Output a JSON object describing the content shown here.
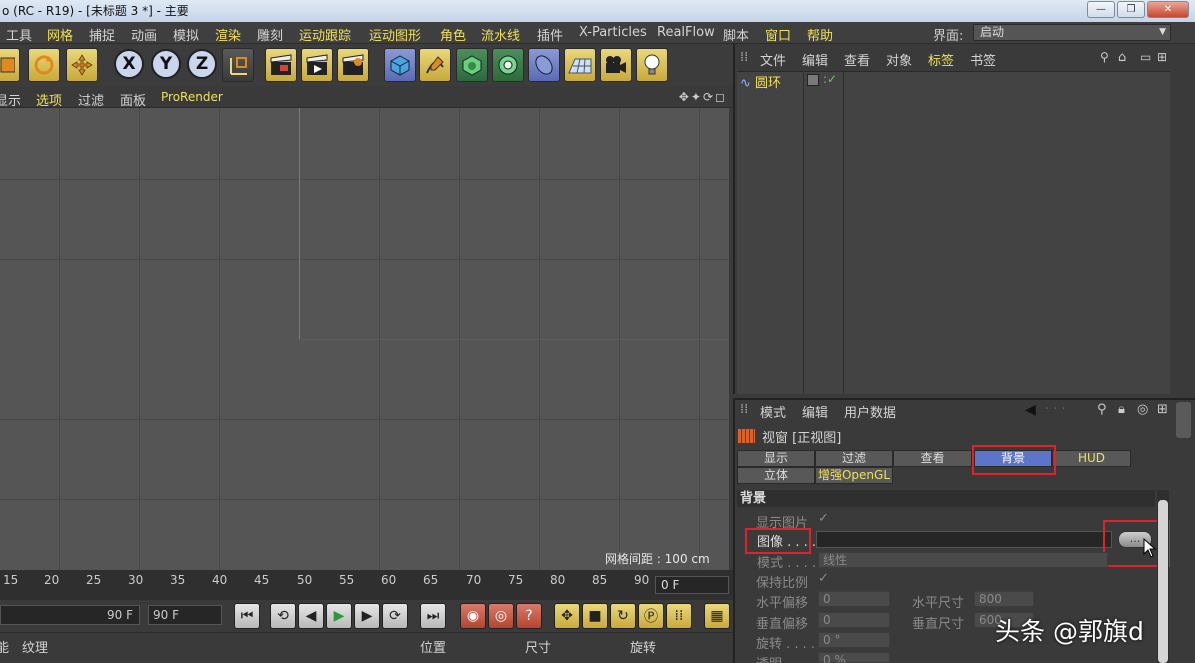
{
  "window": {
    "title": "o (RC - R19) - [未标题 3 *] - 主要",
    "minimize": "—",
    "restore": "❐",
    "close": "✕"
  },
  "menubar": {
    "items": [
      "工具",
      "网格",
      "捕捉",
      "动画",
      "模拟",
      "渲染",
      "雕刻",
      "运动跟踪",
      "运动图形",
      "角色",
      "流水线",
      "插件",
      "X-Particles",
      "RealFlow",
      "脚本",
      "窗口",
      "帮助"
    ],
    "interface_label": "界面:",
    "interface_value": "启动"
  },
  "toolbar": {
    "axis_x": "X",
    "axis_y": "Y",
    "axis_z": "Z"
  },
  "viewport_menu": {
    "items": [
      "显示",
      "选项",
      "过滤",
      "面板",
      "ProRender"
    ],
    "icons": "✥✦⟳◻"
  },
  "viewport": {
    "grid_spacing": "网格间距 : 100 cm"
  },
  "timeline": {
    "ticks": [
      "15",
      "20",
      "25",
      "30",
      "35",
      "40",
      "45",
      "50",
      "55",
      "60",
      "65",
      "70",
      "75",
      "80",
      "85",
      "90"
    ],
    "current_frame": "0 F",
    "end_left": "90 F",
    "end_right": "90 F"
  },
  "bottom_panel": {
    "left_items": [
      "能",
      "纹理"
    ],
    "coord_headers": [
      "位置",
      "尺寸",
      "旋转"
    ]
  },
  "object_manager": {
    "menu": [
      "文件",
      "编辑",
      "查看",
      "对象",
      "标签",
      "书签"
    ],
    "object_name": "圆环"
  },
  "attributes": {
    "menu": [
      "模式",
      "编辑",
      "用户数据"
    ],
    "title": "视窗 [正视图]",
    "tabs_row1": [
      "显示",
      "过滤",
      "查看",
      "背景",
      "HUD"
    ],
    "tabs_row2": [
      "立体",
      "增强OpenGL"
    ],
    "section": "背景",
    "show_image_label": "显示图片",
    "show_image_check": "✓",
    "image_label": "图像 . . . .",
    "image_button": "...",
    "mode_label": "模式 . . . .",
    "mode_value": "线性",
    "keep_ratio_label": "保持比例",
    "keep_ratio_check": "✓",
    "h_offset_label": "水平偏移",
    "h_offset_value": "0",
    "h_size_label": "水平尺寸",
    "h_size_value": "800",
    "v_offset_label": "垂直偏移",
    "v_offset_value": "0",
    "v_size_label": "垂直尺寸",
    "v_size_value": "600",
    "rotate_label": "旋转 . . . .",
    "rotate_value": "0 °",
    "opacity_label": "透明 . . . .",
    "opacity_value": "0 %"
  },
  "watermark": "头条 @郭旗d"
}
